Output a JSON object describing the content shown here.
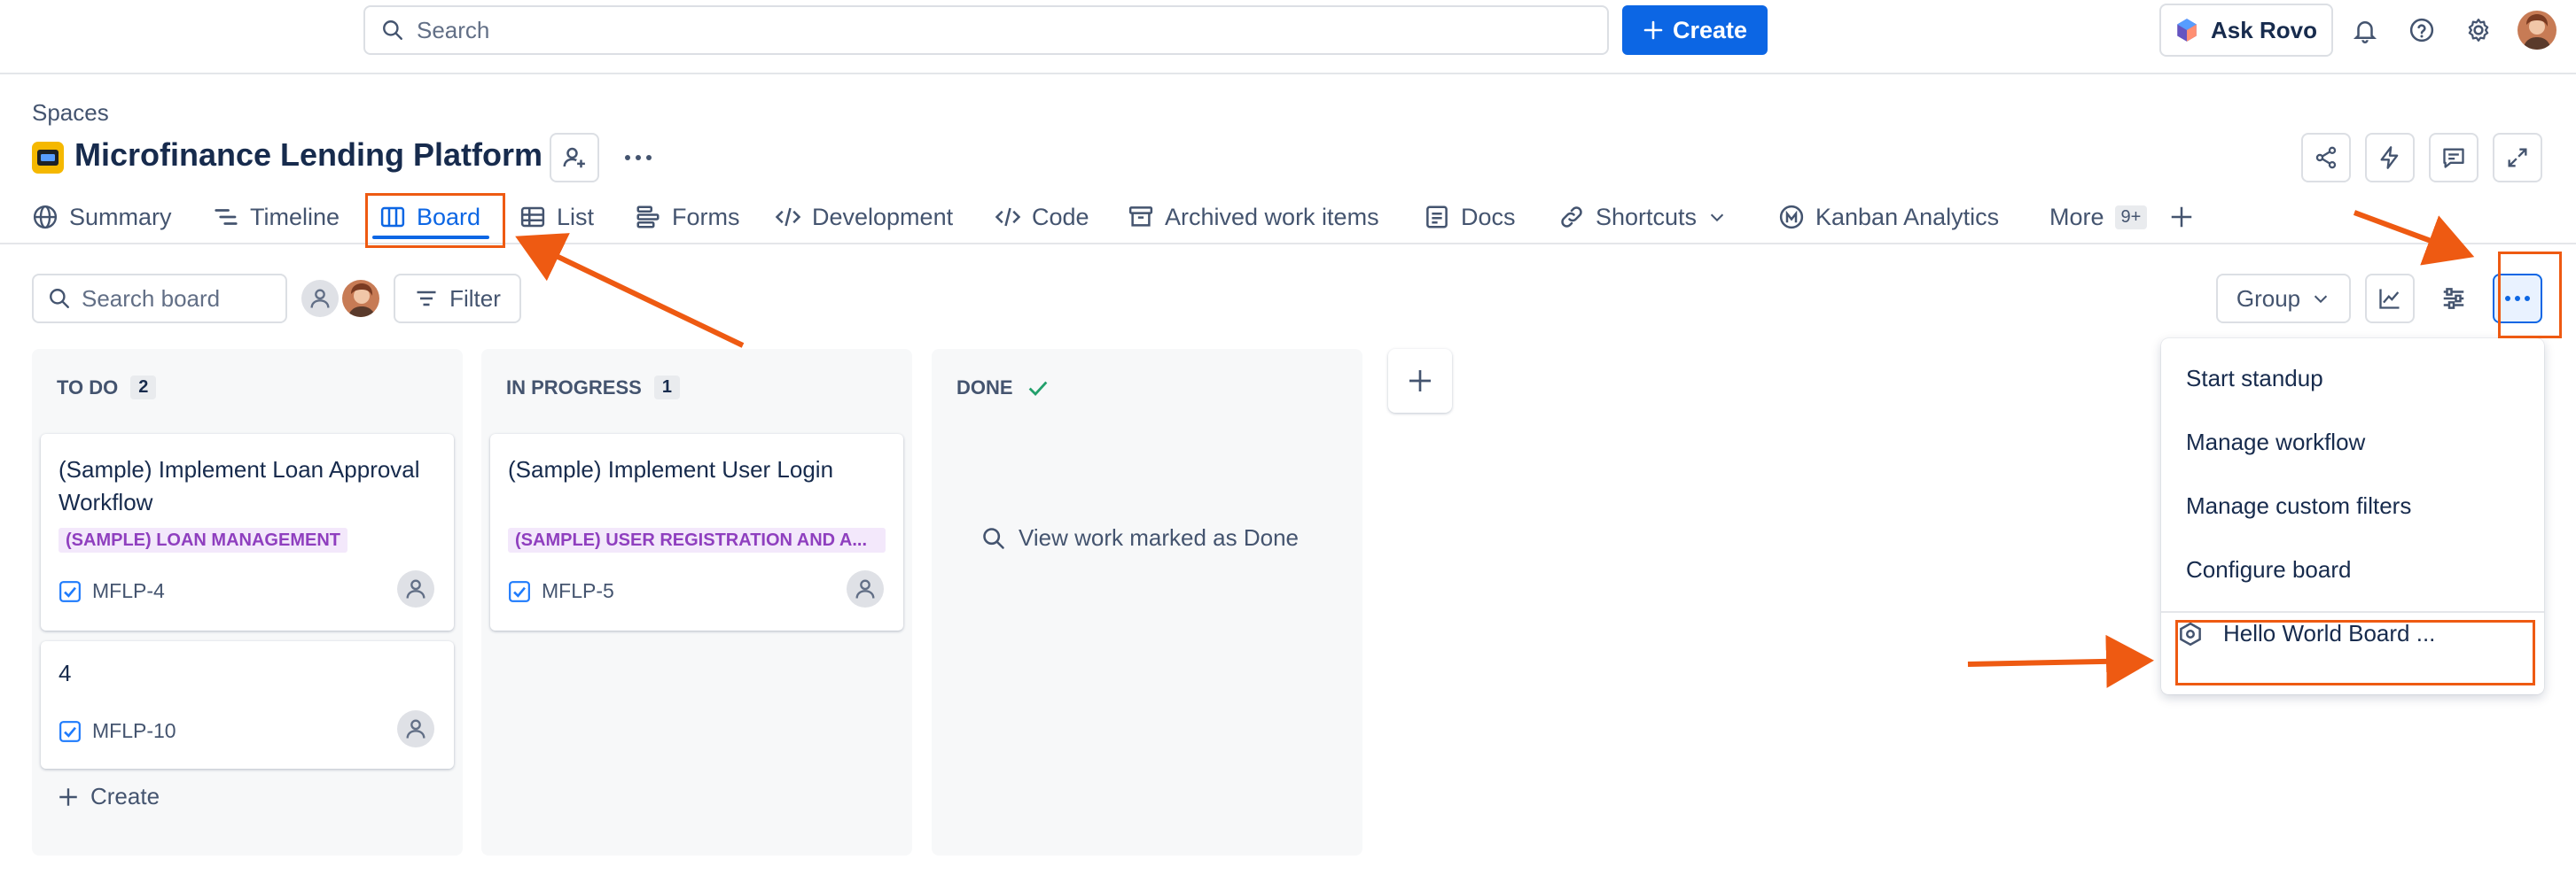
{
  "topbar": {
    "search_placeholder": "Search",
    "create_label": "Create",
    "ask_rovo_label": "Ask Rovo",
    "icons": [
      "search-icon",
      "plus-icon",
      "rovo-icon",
      "bell-icon",
      "help-icon",
      "gear-icon",
      "avatar"
    ]
  },
  "header": {
    "breadcrumb": "Spaces",
    "project_title": "Microfinance Lending Platform",
    "actions": [
      "share-icon",
      "automation-icon",
      "feedback-icon",
      "fullscreen-icon"
    ]
  },
  "tabs": [
    {
      "label": "Summary",
      "icon": "globe-icon"
    },
    {
      "label": "Timeline",
      "icon": "timeline-icon"
    },
    {
      "label": "Board",
      "icon": "board-icon",
      "active": true
    },
    {
      "label": "List",
      "icon": "list-icon"
    },
    {
      "label": "Forms",
      "icon": "forms-icon"
    },
    {
      "label": "Development",
      "icon": "development-icon"
    },
    {
      "label": "Code",
      "icon": "code-icon"
    },
    {
      "label": "Archived work items",
      "icon": "archive-icon"
    },
    {
      "label": "Docs",
      "icon": "docs-icon"
    },
    {
      "label": "Shortcuts",
      "icon": "link-icon"
    },
    {
      "label": "Kanban Analytics",
      "icon": "analytics-icon"
    },
    {
      "label": "More",
      "icon": "none"
    }
  ],
  "more_badge": "9+",
  "board_toolbar": {
    "search_placeholder": "Search board",
    "filter_label": "Filter",
    "group_label": "Group"
  },
  "columns": [
    {
      "title": "TO DO",
      "count": "2",
      "cards": [
        {
          "title": "(Sample) Implement Loan Approval Workflow",
          "label": "(SAMPLE) LOAN MANAGEMENT",
          "key": "MFLP-4"
        },
        {
          "title": "4",
          "label": "",
          "key": "MFLP-10"
        }
      ],
      "create_label": "Create"
    },
    {
      "title": "IN PROGRESS",
      "count": "1",
      "cards": [
        {
          "title": "(Sample) Implement User Login",
          "label": "(SAMPLE) USER REGISTRATION AND A...",
          "key": "MFLP-5"
        }
      ]
    },
    {
      "title": "DONE",
      "view_done_label": "View work marked as Done"
    }
  ],
  "more_menu": {
    "items": [
      "Start standup",
      "Manage workflow",
      "Manage custom filters",
      "Configure board"
    ],
    "app_item": "Hello World Board ..."
  },
  "colors": {
    "brand_blue": "#0c66e4",
    "annotation_orange": "#ee5a12",
    "label_purple": "#8f3fbf",
    "label_bg": "#f3e8fb"
  }
}
